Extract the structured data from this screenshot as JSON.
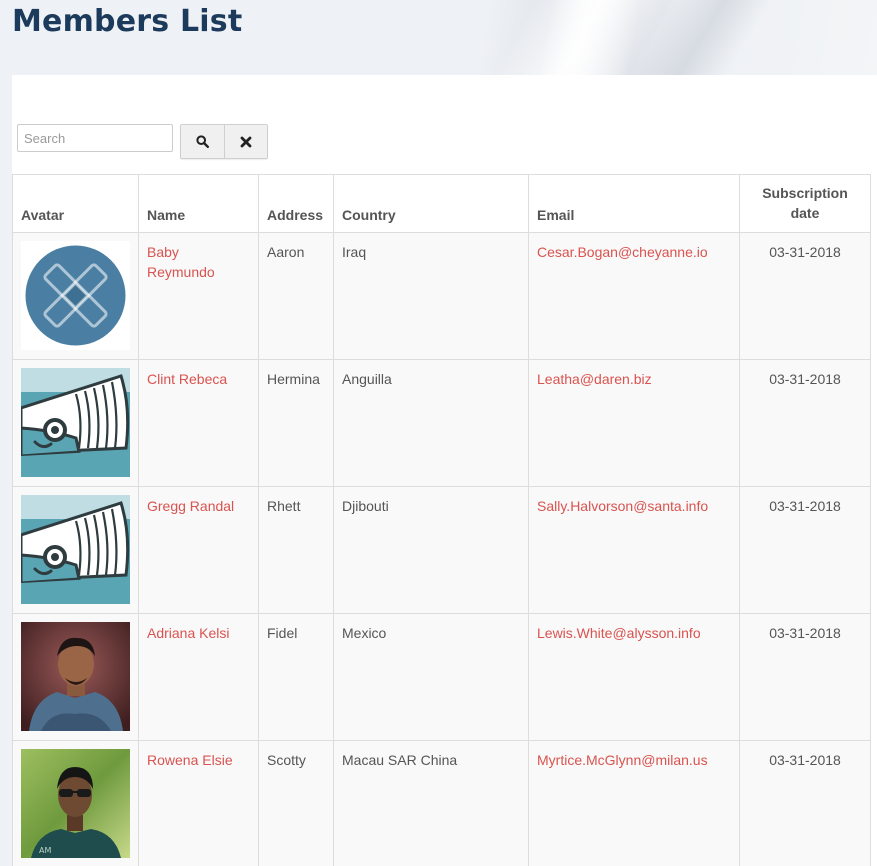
{
  "header": {
    "title": "Members List"
  },
  "search": {
    "placeholder": "Search",
    "value": ""
  },
  "table": {
    "columns": [
      "Avatar",
      "Name",
      "Address",
      "Country",
      "Email",
      "Subscription date"
    ],
    "rows": [
      {
        "avatar": "x-logo-avatar",
        "name": "Baby Reymundo",
        "address": "Aaron",
        "country": "Iraq",
        "email": "Cesar.Bogan@cheyanne.io",
        "date": "03-31-2018"
      },
      {
        "avatar": "whale-avatar",
        "name": "Clint Rebeca",
        "address": "Hermina",
        "country": "Anguilla",
        "email": "Leatha@daren.biz",
        "date": "03-31-2018"
      },
      {
        "avatar": "whale-avatar",
        "name": "Gregg Randal",
        "address": "Rhett",
        "country": "Djibouti",
        "email": "Sally.Halvorson@santa.info",
        "date": "03-31-2018"
      },
      {
        "avatar": "person-photo-avatar",
        "name": "Adriana Kelsi",
        "address": "Fidel",
        "country": "Mexico",
        "email": "Lewis.White@alysson.info",
        "date": "03-31-2018"
      },
      {
        "avatar": "person-sunglasses-avatar",
        "name": "Rowena Elsie",
        "address": "Scotty",
        "country": "Macau SAR China",
        "email": "Myrtice.McGlynn@milan.us",
        "date": "03-31-2018"
      }
    ]
  },
  "colors": {
    "title": "#1b3a5c",
    "link": "#d9534f",
    "text": "#555555",
    "border": "#dddddd"
  }
}
